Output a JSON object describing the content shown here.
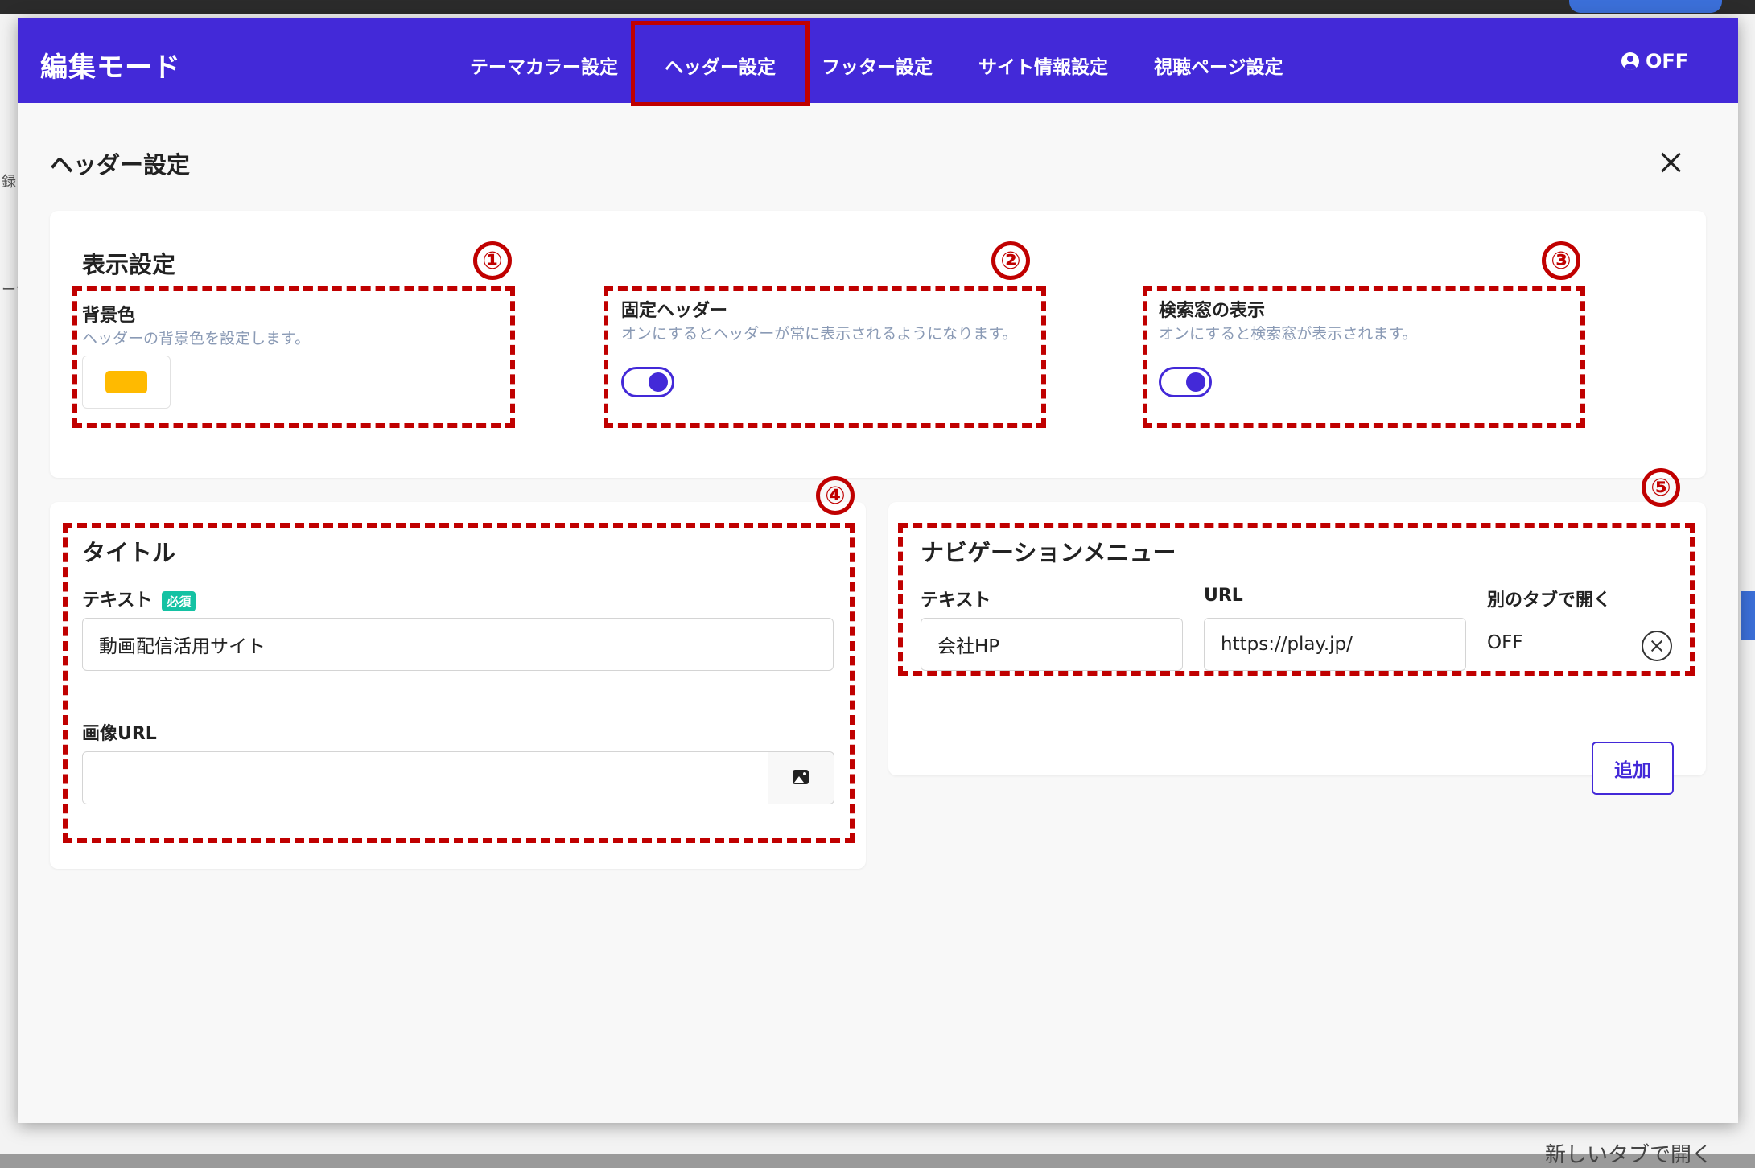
{
  "background": {
    "edge_text_1": "録",
    "edge_text_2": "ージ",
    "bottom_link": "新しいタブで開く"
  },
  "header": {
    "brand": "編集モード",
    "tabs": [
      {
        "label": "テーマカラー設定"
      },
      {
        "label": "ヘッダー設定"
      },
      {
        "label": "フッター設定"
      },
      {
        "label": "サイト情報設定"
      },
      {
        "label": "視聴ページ設定"
      }
    ],
    "active_tab": "ヘッダー設定",
    "status_label": "OFF"
  },
  "page": {
    "title": "ヘッダー設定"
  },
  "display_settings": {
    "title": "表示設定",
    "background_color": {
      "label": "背景色",
      "description": "ヘッダーの背景色を設定します。",
      "color": "#ffba00"
    },
    "fixed_header": {
      "label": "固定ヘッダー",
      "description": "オンにするとヘッダーが常に表示されるようになります。",
      "enabled": true
    },
    "search_box": {
      "label": "検索窓の表示",
      "description": "オンにすると検索窓が表示されます。",
      "enabled": true
    }
  },
  "title_section": {
    "title": "タイトル",
    "text_label": "テキスト",
    "required_badge": "必須",
    "text_value": "動画配信活用サイト",
    "image_url_label": "画像URL",
    "image_url_value": ""
  },
  "nav_menu": {
    "title": "ナビゲーションメニュー",
    "col_text": "テキスト",
    "col_url": "URL",
    "col_new_tab": "別のタブで開く",
    "items": [
      {
        "text": "会社HP",
        "url": "https://play.jp/",
        "new_tab": "OFF"
      }
    ],
    "add_label": "追加"
  },
  "markers": [
    "①",
    "②",
    "③",
    "④",
    "⑤"
  ],
  "colors": {
    "header_bg": "#4329d8",
    "annotation": "#c00000",
    "badge": "#14c2a3"
  }
}
